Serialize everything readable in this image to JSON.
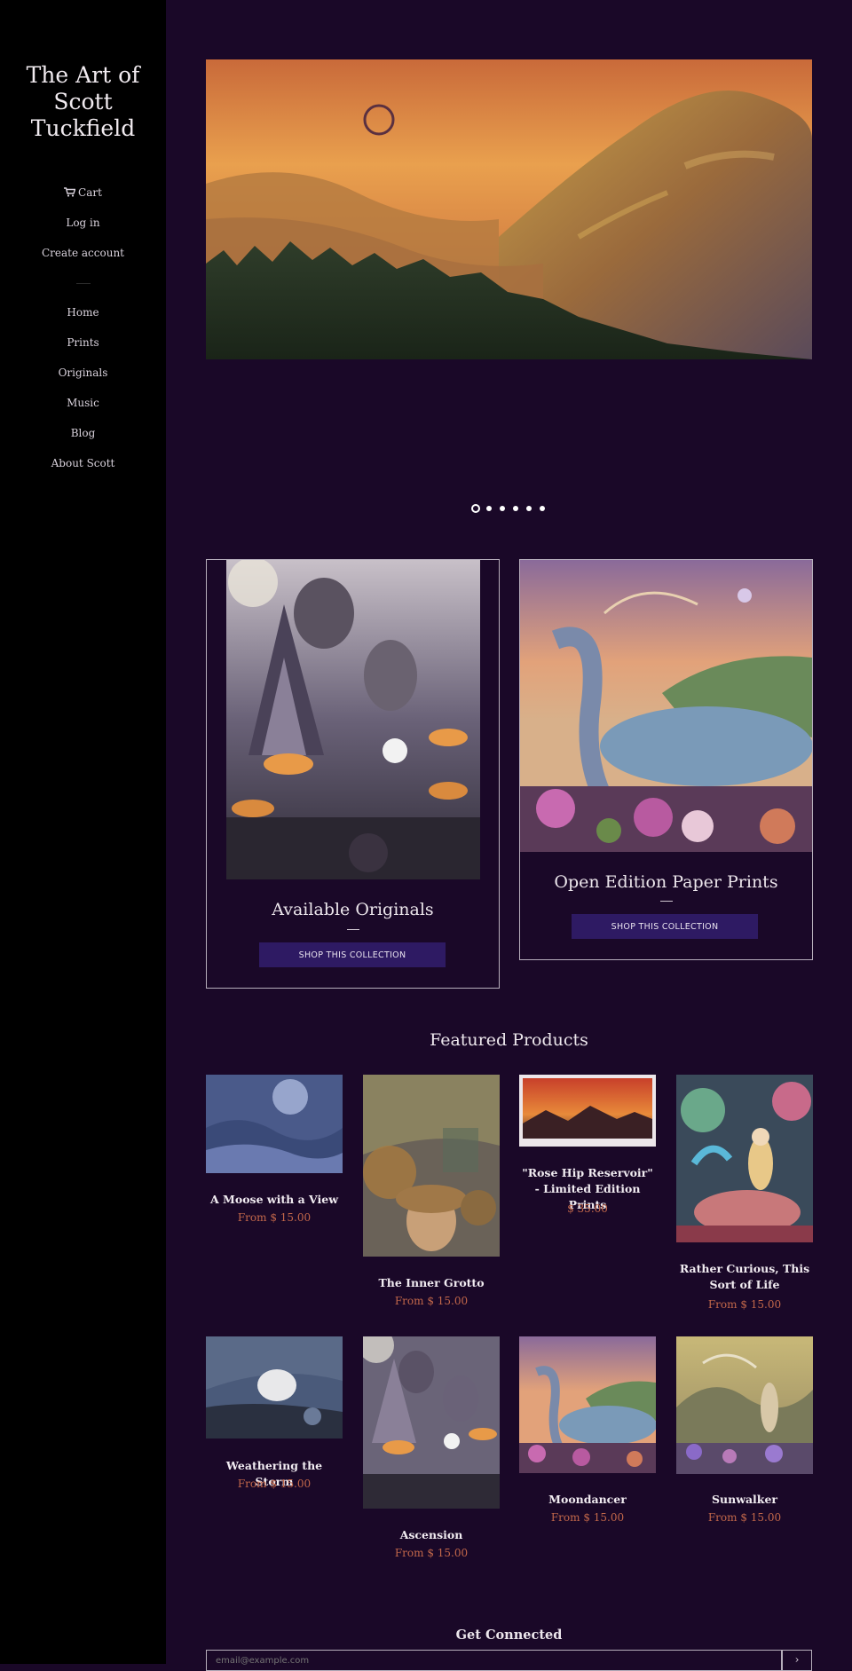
{
  "sidebar": {
    "title": "The Art of Scott Tuckfield",
    "account": [
      {
        "label": "Cart",
        "icon": "cart-icon"
      },
      {
        "label": "Log in"
      },
      {
        "label": "Create account"
      }
    ],
    "nav": [
      "Home",
      "Prints",
      "Originals",
      "Music",
      "Blog",
      "About Scott"
    ]
  },
  "slideshow": {
    "slide_count": 6,
    "active_index": 0
  },
  "collections": [
    {
      "title": "Available Originals",
      "button": "SHOP THIS COLLECTION"
    },
    {
      "title": "Open Edition Paper Prints",
      "button": "SHOP THIS COLLECTION"
    }
  ],
  "featured": {
    "title": "Featured Products",
    "products": [
      {
        "name": "A Moose with a View",
        "price": "From $ 15.00"
      },
      {
        "name": "The Inner Grotto",
        "price": "From $ 15.00"
      },
      {
        "name": "\"Rose Hip Reservoir\" - Limited Edition Prints",
        "price": "$ 35.00"
      },
      {
        "name": "Rather Curious, This Sort of Life",
        "price": "From $ 15.00"
      },
      {
        "name": "Weathering the Storm",
        "price": "From $ 15.00"
      },
      {
        "name": "Ascension",
        "price": "From $ 15.00"
      },
      {
        "name": "Moondancer",
        "price": "From $ 15.00"
      },
      {
        "name": "Sunwalker",
        "price": "From $ 15.00"
      }
    ]
  },
  "newsletter": {
    "title": "Get Connected",
    "placeholder": "email@example.com",
    "submit": "›"
  },
  "colors": {
    "background": "#1a0828",
    "sidebar": "#000000",
    "button": "#2e1a63",
    "price": "#c2674a"
  }
}
